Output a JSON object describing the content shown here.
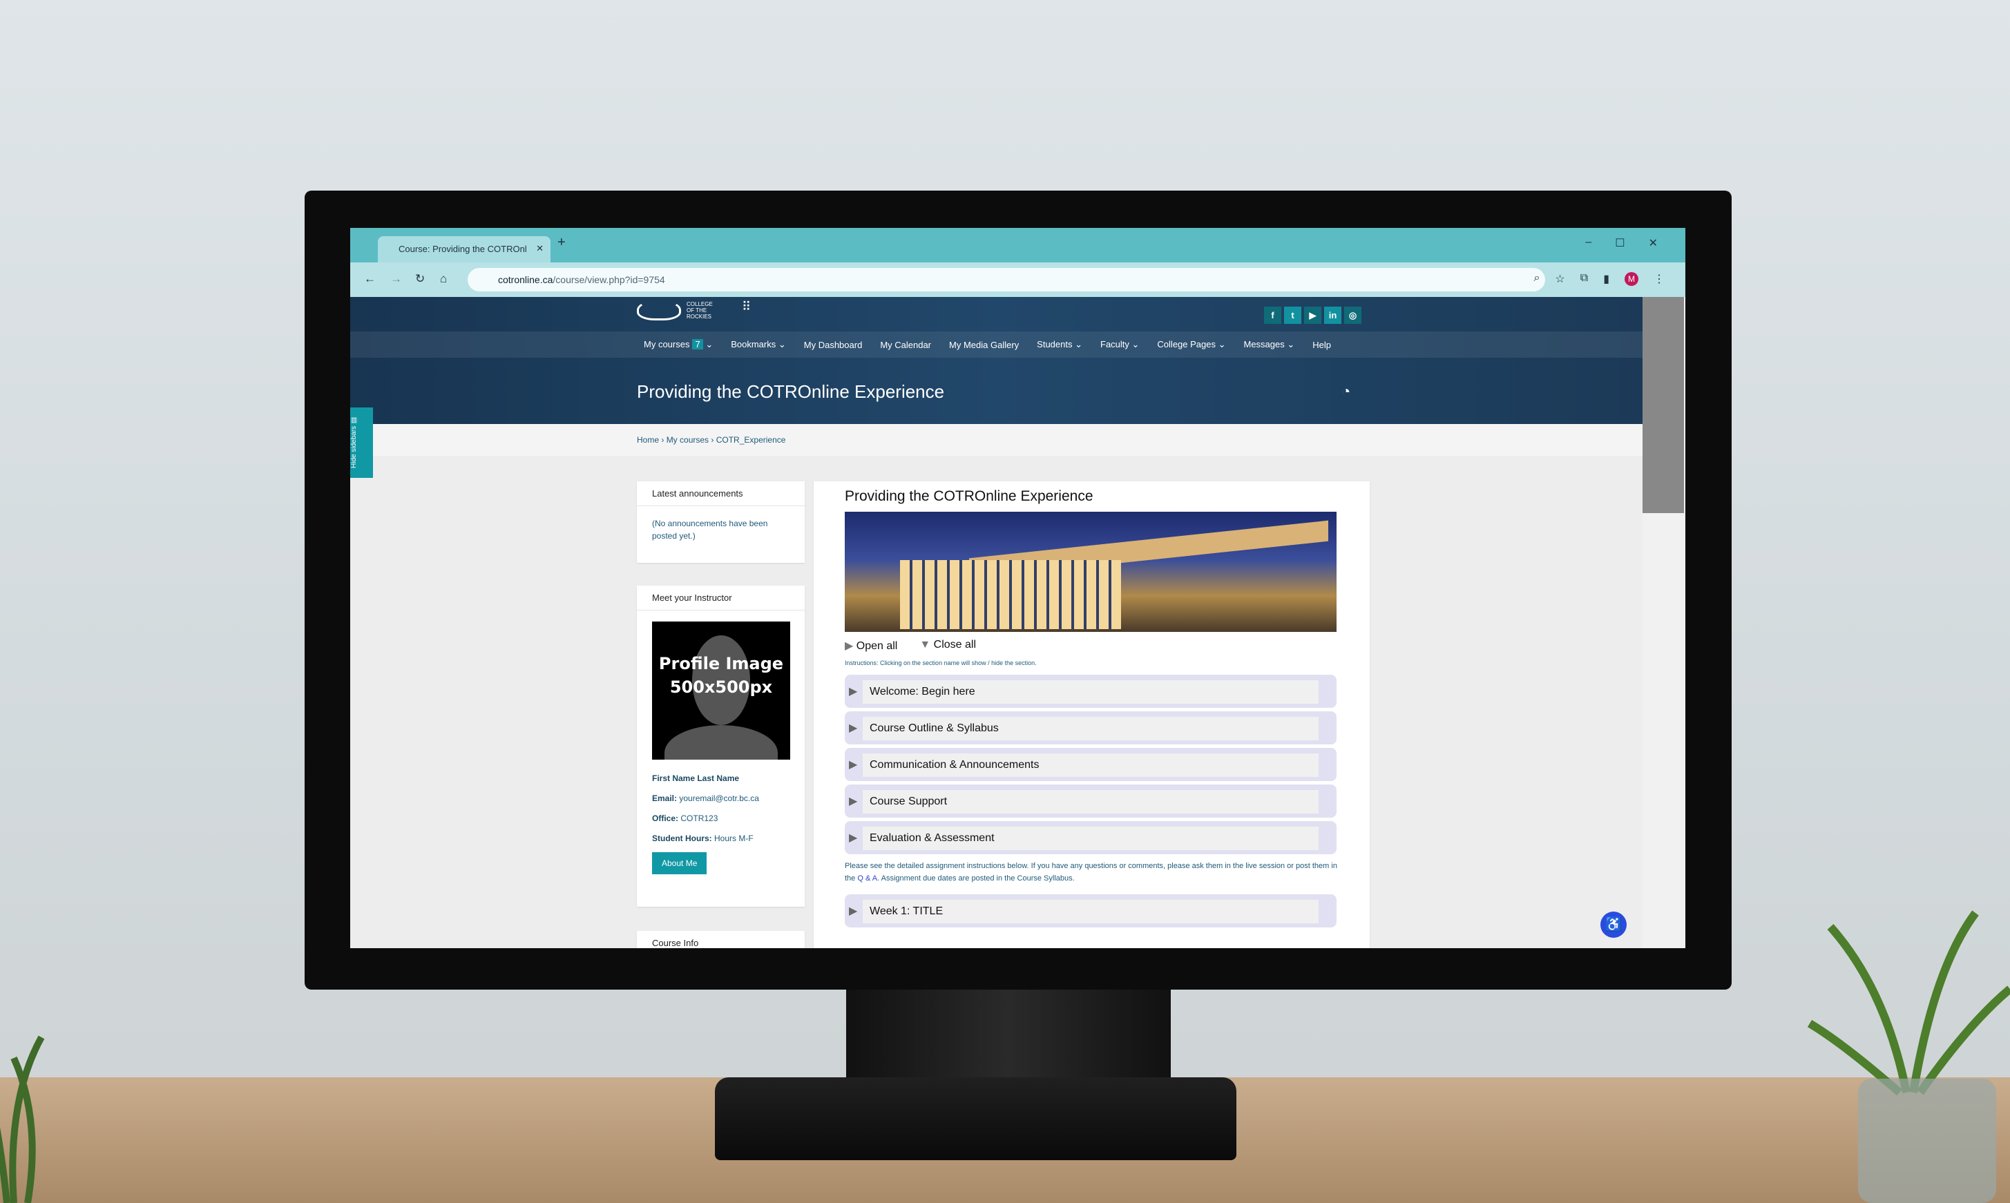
{
  "browser": {
    "tab_title": "Course: Providing the COTROnl",
    "url_domain": "cotronline.ca",
    "url_path": "/course/view.php?id=9754",
    "avatar_letter": "M"
  },
  "header": {
    "logo_text": "COLLEGE OF THE ROCKIES",
    "social": [
      "f",
      "t",
      "▶",
      "in",
      "◎"
    ],
    "nav": [
      {
        "label": "My courses",
        "badge": "7",
        "dropdown": true
      },
      {
        "label": "Bookmarks",
        "dropdown": true
      },
      {
        "label": "My Dashboard"
      },
      {
        "label": "My Calendar"
      },
      {
        "label": "My Media Gallery"
      },
      {
        "label": "Students",
        "dropdown": true
      },
      {
        "label": "Faculty",
        "dropdown": true
      },
      {
        "label": "College Pages",
        "dropdown": true
      },
      {
        "label": "Messages",
        "dropdown": true
      },
      {
        "label": "Help"
      }
    ],
    "title": "Providing the COTROnline Experience"
  },
  "breadcrumb": [
    "Home",
    "My courses",
    "COTR_Experience"
  ],
  "sidebar_toggle": "Hide sidebars",
  "blocks": {
    "announcements": {
      "title": "Latest announcements",
      "text": "(No announcements have been posted yet.)"
    },
    "instructor": {
      "title": "Meet your Instructor",
      "image_text": "Profile Image 500x500px",
      "name": "First Name Last Name",
      "email_label": "Email:",
      "email": "youremail@cotr.bc.ca",
      "office_label": "Office:",
      "office": "COTR123",
      "hours_label": "Student Hours:",
      "hours": "Hours M-F",
      "button": "About Me"
    },
    "course_info": {
      "title": "Course Info"
    }
  },
  "main": {
    "title": "Providing the COTROnline Experience",
    "open_all": "Open all",
    "close_all": "Close all",
    "instructions": "Instructions: Clicking on the section name will show / hide the section.",
    "sections": [
      "Welcome: Begin here",
      "Course Outline & Syllabus",
      "Communication & Announcements",
      "Course Support",
      "Evaluation & Assessment"
    ],
    "note_before": "Please see the detailed assignment instructions below. If you have any questions or comments, please ask them in the live session or post them in the ",
    "note_link": "Q & A",
    "note_after": ". Assignment due dates are posted in the Course Syllabus.",
    "week_section": "Week 1: TITLE"
  },
  "colors": {
    "teal": "#1198a5",
    "header": "#1f3c5a",
    "section": "#e1e0f2"
  }
}
